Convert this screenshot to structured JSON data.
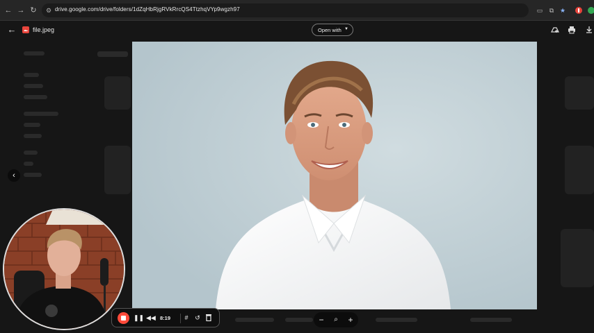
{
  "browser": {
    "url": "drive.google.com/drive/folders/1dZqHbRjgRVkRrcQS4TtzhqVYp9wgzh97"
  },
  "viewer": {
    "file_name": "file.jpeg",
    "open_with_label": "Open with"
  },
  "recorder": {
    "time": "8:19"
  },
  "colors": {
    "record_red": "#ff4a3a",
    "file_icon_red": "#e8453c",
    "photo_bg": "#c4d1d6"
  }
}
